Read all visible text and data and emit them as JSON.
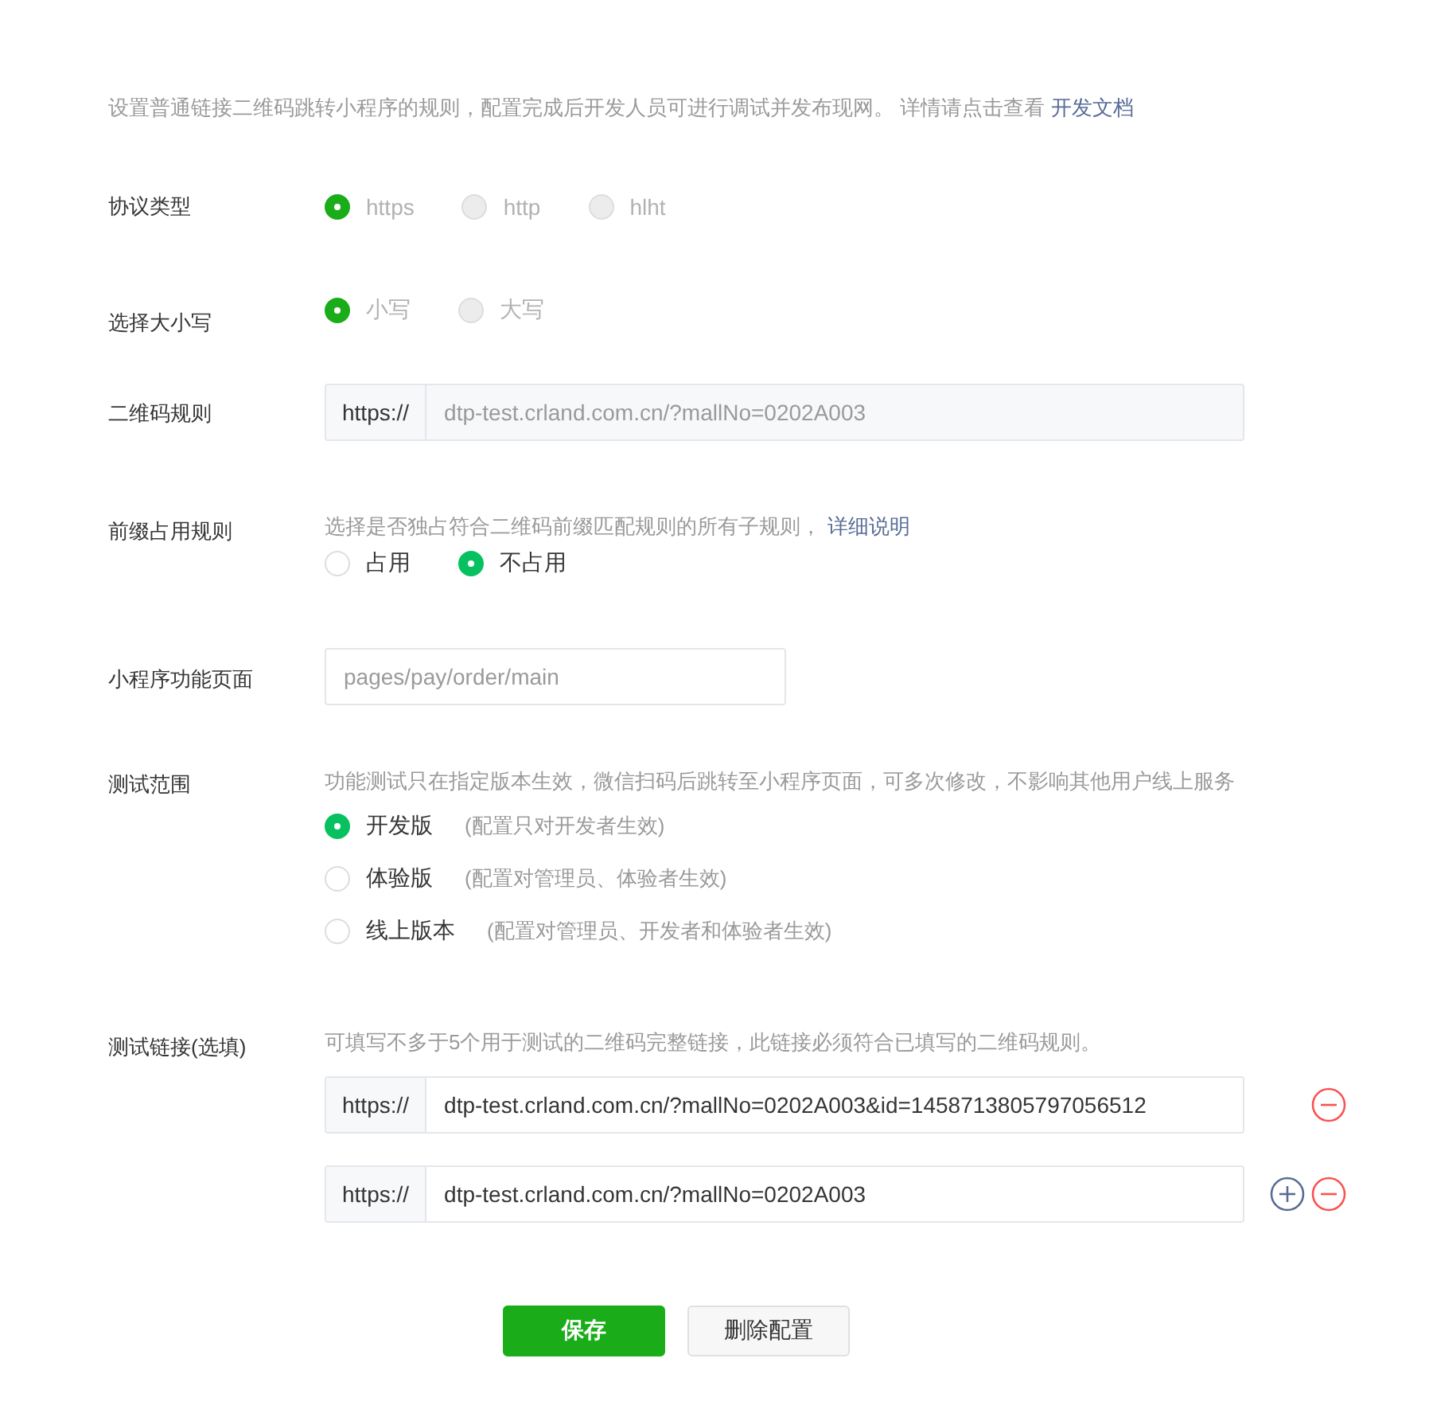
{
  "intro": {
    "text": "设置普通链接二维码跳转小程序的规则，配置完成后开发人员可进行调试并发布现网。 详情请点击查看",
    "link": "开发文档"
  },
  "protocol": {
    "label": "协议类型",
    "disabled": true,
    "options": [
      {
        "label": "https",
        "selected": true
      },
      {
        "label": "http",
        "selected": false
      },
      {
        "label": "hlht",
        "selected": false
      }
    ]
  },
  "letter_case": {
    "label": "选择大小写",
    "disabled": true,
    "options": [
      {
        "label": "小写",
        "selected": true
      },
      {
        "label": "大写",
        "selected": false
      }
    ]
  },
  "qr_rule": {
    "label": "二维码规则",
    "prefix": "https://",
    "value": "dtp-test.crland.com.cn/?mallNo=0202A003",
    "disabled": true
  },
  "prefix_rule": {
    "label": "前缀占用规则",
    "hint": "选择是否独占符合二维码前缀匹配规则的所有子规则，",
    "link": "详细说明",
    "disabled": false,
    "options": [
      {
        "label": "占用",
        "selected": false
      },
      {
        "label": "不占用",
        "selected": true
      }
    ]
  },
  "page": {
    "label": "小程序功能页面",
    "placeholder": "pages/pay/order/main"
  },
  "test_scope": {
    "label": "测试范围",
    "hint": "功能测试只在指定版本生效，微信扫码后跳转至小程序页面，可多次修改，不影响其他用户线上服务",
    "options": [
      {
        "label": "开发版",
        "note": "(配置只对开发者生效)",
        "selected": true
      },
      {
        "label": "体验版",
        "note": "(配置对管理员、体验者生效)",
        "selected": false
      },
      {
        "label": "线上版本",
        "note": "(配置对管理员、开发者和体验者生效)",
        "selected": false
      }
    ]
  },
  "test_links": {
    "label": "测试链接(选填)",
    "hint": "可填写不多于5个用于测试的二维码完整链接，此链接必须符合已填写的二维码规则。",
    "links": [
      {
        "prefix": "https://",
        "value": "dtp-test.crland.com.cn/?mallNo=0202A003&id=1458713805797056512",
        "can_add": false
      },
      {
        "prefix": "https://",
        "value": "dtp-test.crland.com.cn/?mallNo=0202A003",
        "can_add": true
      }
    ]
  },
  "buttons": {
    "save": "保存",
    "delete": "删除配置"
  }
}
